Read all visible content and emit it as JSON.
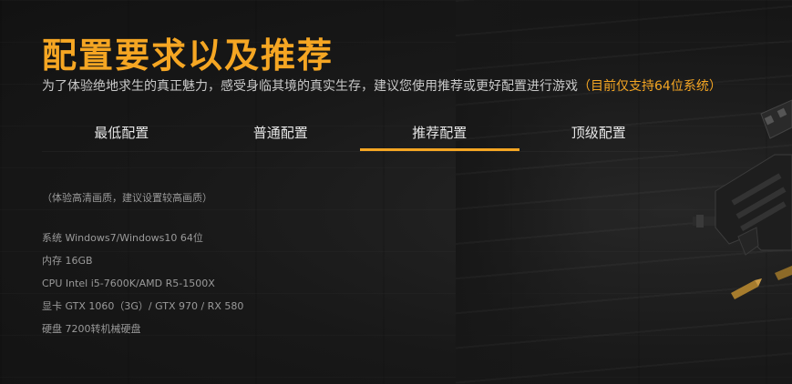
{
  "header": {
    "title": "配置要求以及推荐",
    "subtitle": "为了体验绝地求生的真正魅力，感受身临其境的真实生存，建议您使用推荐或更好配置进行游戏",
    "subtitle_note": "（目前仅支持64位系统）"
  },
  "tabs": [
    {
      "label": "最低配置",
      "active": false
    },
    {
      "label": "普通配置",
      "active": false
    },
    {
      "label": "推荐配置",
      "active": true
    },
    {
      "label": "顶级配置",
      "active": false
    }
  ],
  "specs": {
    "note": "（体验高清画质，建议设置较高画质）",
    "items": [
      "系统 Windows7/Windows10 64位",
      "内存 16GB",
      "CPU Intel i5-7600K/AMD R5-1500X",
      "显卡 GTX 1060（3G）/ GTX 970 / RX 580",
      "硬盘 7200转机械硬盘"
    ]
  },
  "colors": {
    "accent": "#f5a623",
    "background": "#171717",
    "text": "#c9c9c9",
    "muted_text": "#9a9a9a"
  },
  "icons": {
    "decoration": "rifle-illustration"
  }
}
